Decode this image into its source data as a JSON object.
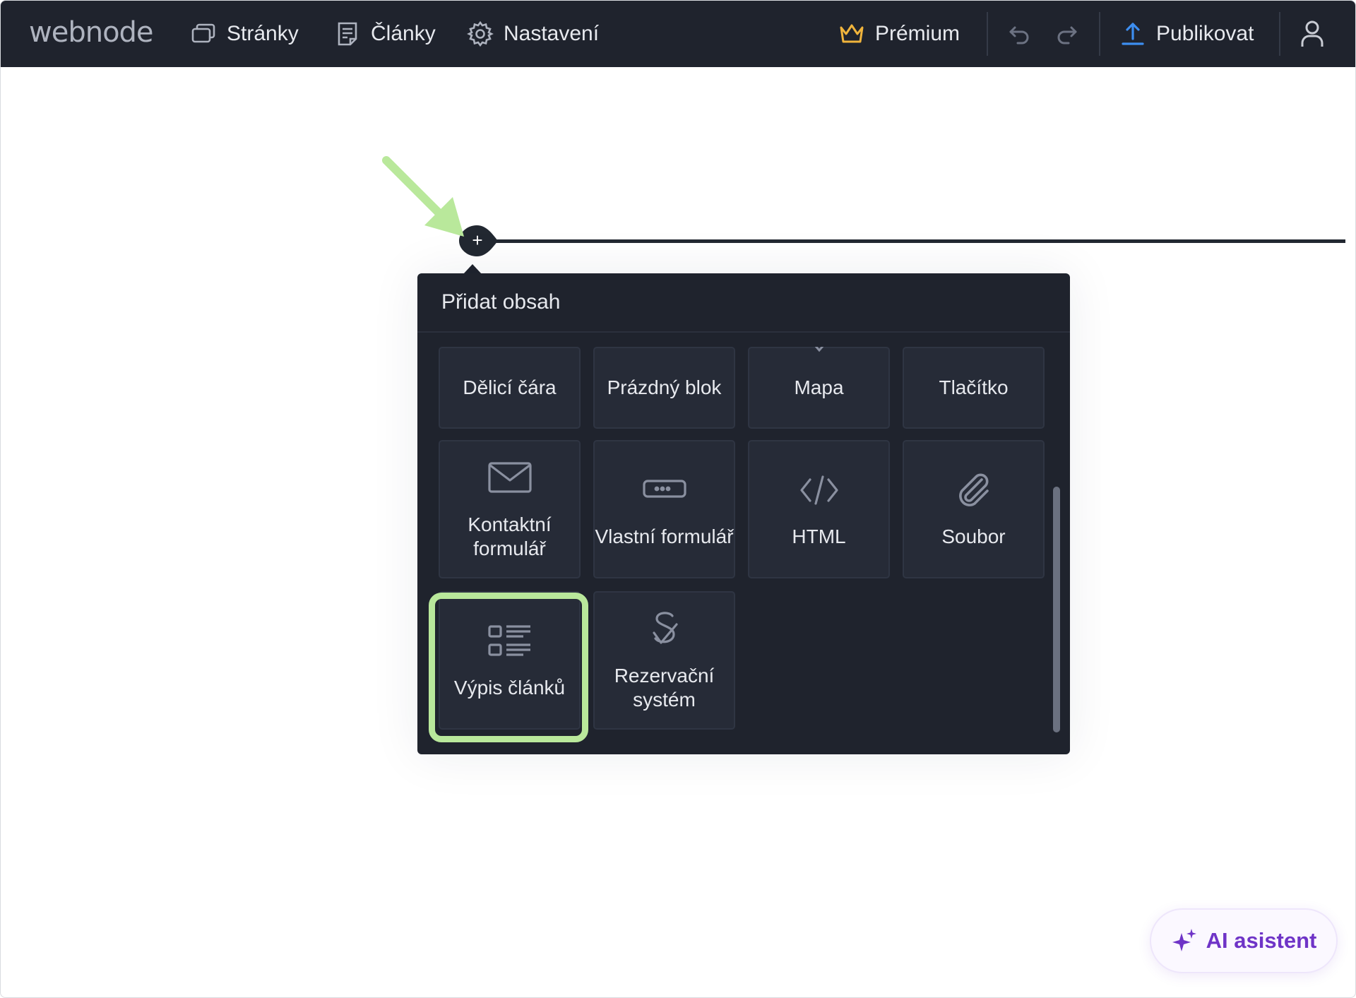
{
  "app": {
    "logo": "webnode"
  },
  "nav": {
    "pages": "Stránky",
    "articles": "Články",
    "settings": "Nastavení"
  },
  "toolbar": {
    "premium": "Prémium",
    "publish": "Publikovat"
  },
  "colors": {
    "topbar_bg": "#1f232d",
    "premium_crown": "#f0b43c",
    "publish_icon": "#3d8ef0",
    "highlight": "#b9e89b",
    "arrow": "#b9e89b",
    "ai_accent": "#6f34c7"
  },
  "popup": {
    "title": "Přidat obsah",
    "tiles": [
      {
        "label": "Dělicí čára",
        "icon": "divider-icon"
      },
      {
        "label": "Prázdný blok",
        "icon": "empty-block-icon"
      },
      {
        "label": "Mapa",
        "icon": "map-pin-icon"
      },
      {
        "label": "Tlačítko",
        "icon": "button-icon"
      },
      {
        "label": "Kontaktní formulář",
        "icon": "envelope-icon"
      },
      {
        "label": "Vlastní formulář",
        "icon": "form-field-icon"
      },
      {
        "label": "HTML",
        "icon": "code-icon"
      },
      {
        "label": "Soubor",
        "icon": "paperclip-icon"
      },
      {
        "label": "Výpis článků",
        "icon": "article-list-icon"
      },
      {
        "label": "Rezervační systém",
        "icon": "reservation-icon"
      }
    ]
  },
  "ai": {
    "label": "AI asistent"
  }
}
